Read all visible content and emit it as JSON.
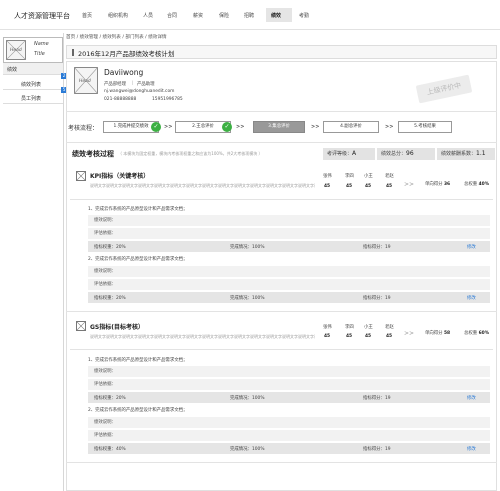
{
  "app": {
    "title": "人才资源管理平台"
  },
  "nav": {
    "items": [
      "首页",
      "组织机构",
      "人员",
      "合同",
      "薪资",
      "保险",
      "招聘",
      "绩效",
      "考勤"
    ],
    "active": "绩效"
  },
  "sidebar": {
    "profile": {
      "avatar": "Head",
      "name": "Name",
      "title": "Title"
    },
    "section": "绩效",
    "items": [
      {
        "label": "绩效列表",
        "badge": "2"
      },
      {
        "label": "员工列表",
        "badge": "5"
      }
    ]
  },
  "breadcrumb": "首页 / 绩效管理 / 绩效列表 / 部门列表 / 绩效详情",
  "page_title": "2016年12月产品部绩效考核计划",
  "employee": {
    "avatar": "Head",
    "name": "Daviiwong",
    "dept": "产品部经理",
    "role": "产品助理",
    "email": "nj.wangwei@donghuanedit.com",
    "phone": "021-88888888",
    "mobile": "15951996785",
    "stamp": "上级评价中"
  },
  "flow": {
    "label": "考核流程：",
    "steps": [
      "1.完成并提交绩效",
      "2.王总评价",
      "3.集总评价",
      "4.副总评价",
      "5.考核结果"
    ]
  },
  "grade": {
    "title": "绩效考核过程",
    "hint": "（ 本模块为固定权重，模块内考核项权重之和应该为100%，共2大考核项模块 ）",
    "level_label": "考评等级：",
    "level": "A",
    "score_label": "绩效总分：",
    "score": "96",
    "coef_label": "绩效薪酬系数：",
    "coef": "1.1"
  },
  "modules": [
    {
      "title": "KPI指标（关键考核）",
      "desc": "说明文字说明文字说明文字说明文字说明文字说明文字说明文字说明文字说明文字说明文字说明文字说明文字说明文字说明文字说明文字说明文字",
      "raters": [
        {
          "name": "张伟",
          "score": "45"
        },
        {
          "name": "李四",
          "score": "45"
        },
        {
          "name": "小王",
          "score": "45"
        },
        {
          "name": "老赵",
          "score": "45"
        }
      ],
      "single_label": "单向得分",
      "single": "36",
      "weight_label": "总权重",
      "weight": "40%",
      "items": [
        {
          "title": "1、完成云作系统的产品原型设计和产品需求文档；",
          "desc_label": "绩效说明：",
          "basis_label": "评估依据：",
          "weight": "指标权重：20%",
          "completion": "完成情况：100%",
          "score": "指标得分：19",
          "edit": "修改"
        },
        {
          "title": "2、完成云作系统的产品原型设计和产品需求文档；",
          "desc_label": "绩效说明：",
          "basis_label": "评估依据：",
          "weight": "指标权重：20%",
          "completion": "完成情况：100%",
          "score": "指标得分：19",
          "edit": "修改"
        }
      ]
    },
    {
      "title": "GS指标(目标考核）",
      "desc": "说明文字说明文字说明文字说明文字说明文字说明文字说明文字说明文字说明文字说明文字说明文字说明文字说明文字说明文字说明文字说明文字",
      "raters": [
        {
          "name": "张伟",
          "score": "45"
        },
        {
          "name": "李四",
          "score": "45"
        },
        {
          "name": "小王",
          "score": "45"
        },
        {
          "name": "老赵",
          "score": "45"
        }
      ],
      "single_label": "单向得分",
      "single": "58",
      "weight_label": "总权重",
      "weight": "60%",
      "items": [
        {
          "title": "1、完成云作系统的产品原型设计和产品需求文档；",
          "desc_label": "绩效说明：",
          "basis_label": "评估依据：",
          "weight": "指标权重：20%",
          "completion": "完成情况：100%",
          "score": "指标得分：19",
          "edit": "修改"
        },
        {
          "title": "2、完成云作系统的产品原型设计和产品需求文档；",
          "desc_label": "绩效说明：",
          "basis_label": "评估依据：",
          "weight": "指标权重：40%",
          "completion": "完成情况：100%",
          "score": "指标得分：19",
          "edit": "修改"
        }
      ]
    }
  ]
}
